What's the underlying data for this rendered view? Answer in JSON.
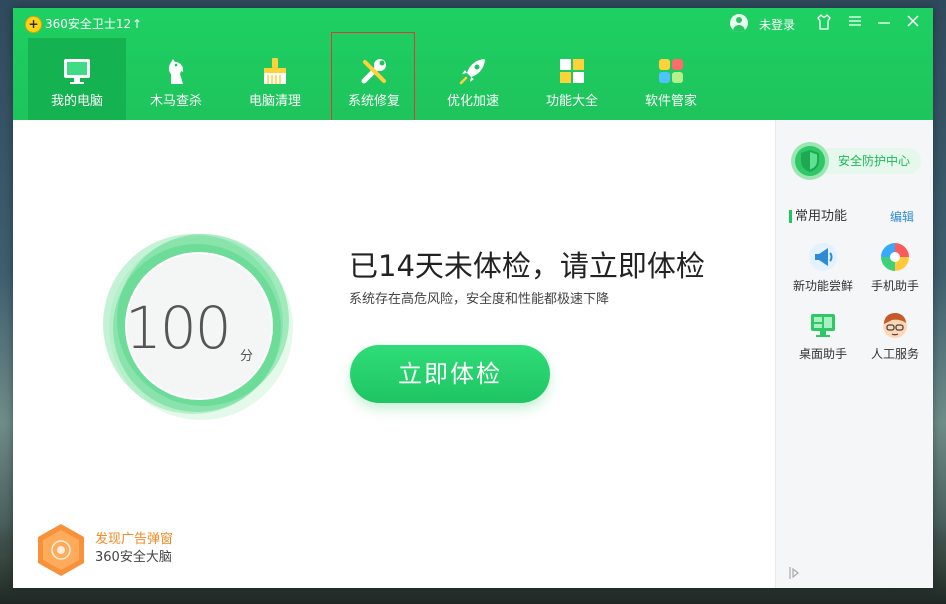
{
  "app": {
    "title": "360安全卫士12"
  },
  "user": {
    "login_label": "未登录"
  },
  "nav": {
    "items": [
      {
        "label": "我的电脑",
        "icon": "monitor-icon"
      },
      {
        "label": "木马查杀",
        "icon": "horse-icon"
      },
      {
        "label": "电脑清理",
        "icon": "broom-icon"
      },
      {
        "label": "系统修复",
        "icon": "wrench-icon"
      },
      {
        "label": "优化加速",
        "icon": "rocket-icon"
      },
      {
        "label": "功能大全",
        "icon": "grid-icon"
      },
      {
        "label": "软件管家",
        "icon": "apps-icon"
      }
    ],
    "active_index": 0
  },
  "main": {
    "score": "100",
    "score_unit": "分",
    "headline": "已14天未体检，请立即体检",
    "subline": "系统存在高危风险，安全度和性能都极速下降",
    "check_button": "立即体检",
    "ad": {
      "title": "发现广告弹窗",
      "subtitle": "360安全大脑"
    }
  },
  "sidebar": {
    "protect_label": "安全防护中心",
    "section_title": "常用功能",
    "edit_label": "编辑",
    "functions": [
      {
        "label": "新功能尝鲜",
        "icon": "megaphone-icon"
      },
      {
        "label": "手机助手",
        "icon": "phone-helper-icon"
      },
      {
        "label": "桌面助手",
        "icon": "desktop-helper-icon"
      },
      {
        "label": "人工服务",
        "icon": "service-agent-icon"
      }
    ]
  },
  "colors": {
    "brand_green": "#1ec45c",
    "accent_orange": "#f08a24",
    "link_blue": "#2f8ad6",
    "highlight_red": "#e0383c"
  }
}
